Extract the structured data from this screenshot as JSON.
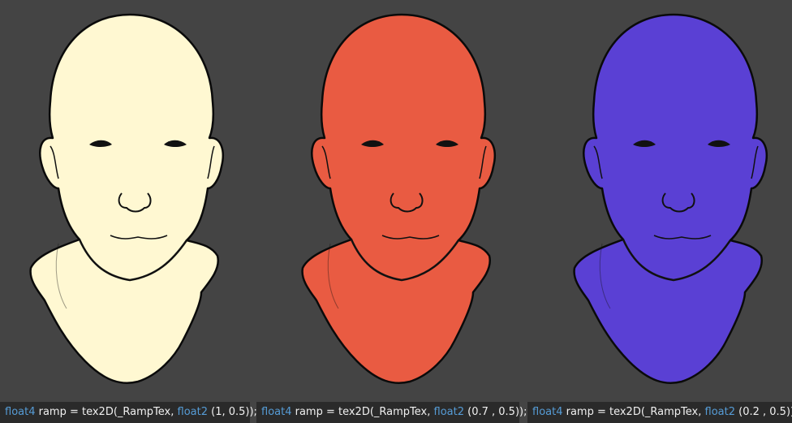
{
  "background_color": "#444444",
  "panels": [
    {
      "fill_color": "#fff8d2",
      "code": {
        "type_kw": "float4",
        "mid": " ramp = tex2D(_RampTex, ",
        "arg_kw": "float2",
        "args": " (1, 0.5));"
      }
    },
    {
      "fill_color": "#e95b42",
      "code": {
        "type_kw": "float4",
        "mid": " ramp = tex2D(_RampTex, ",
        "arg_kw": "float2",
        "args": " (0.7 , 0.5));"
      }
    },
    {
      "fill_color": "#5a40d4",
      "code": {
        "type_kw": "float4",
        "mid": " ramp = tex2D(_RampTex, ",
        "arg_kw": "float2",
        "args": " (0.2 , 0.5));"
      }
    }
  ]
}
